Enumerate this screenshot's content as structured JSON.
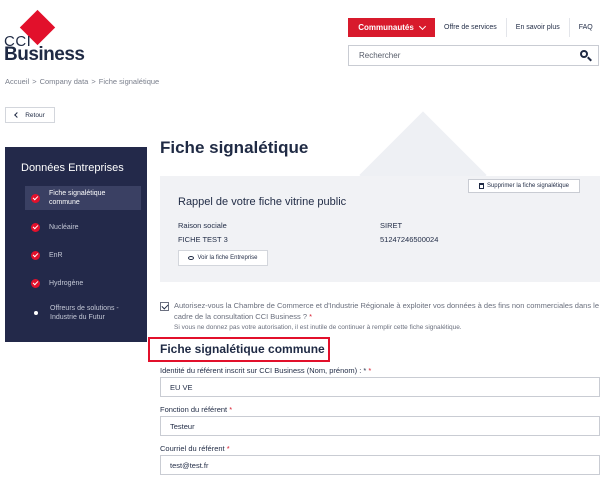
{
  "logo": {
    "line1": "CCI",
    "line2": "Business"
  },
  "nav": {
    "communautes": "Communautés",
    "links": [
      "Offre de services",
      "En savoir plus",
      "FAQ"
    ]
  },
  "search": {
    "placeholder": "Rechercher"
  },
  "breadcrumb": [
    "Accueil",
    ">",
    "Company data",
    ">",
    "Fiche signalétique"
  ],
  "back_label": "Retour",
  "sidebar": {
    "title": "Données Entreprises",
    "items": [
      {
        "label": "Fiche signalétique commune",
        "state": "checked",
        "active": true
      },
      {
        "label": "Nucléaire",
        "state": "checked",
        "active": false
      },
      {
        "label": "EnR",
        "state": "checked",
        "active": false
      },
      {
        "label": "Hydrogène",
        "state": "checked",
        "active": false
      },
      {
        "label": "Offreurs de solutions - Industrie du Futur",
        "state": "dot",
        "active": false
      }
    ]
  },
  "page_title": "Fiche signalétique",
  "card": {
    "heading": "Rappel de votre fiche vitrine public",
    "delete_label": "Supprimer la fiche signalétique",
    "raison_sociale_label": "Raison sociale",
    "raison_sociale_value": "FICHE TEST 3",
    "siret_label": "SIRET",
    "siret_value": "51247246500024",
    "view_label": "Voir la fiche Entreprise"
  },
  "consent": {
    "text": "Autorisez-vous la Chambre de Commerce et d'Industrie Régionale à exploiter vos données à des fins non commerciales dans le cadre de la consultation CCI Business ?",
    "required_mark": "*",
    "checked": true
  },
  "note": "Si vous ne donnez pas votre autorisation, il est inutile de continuer à remplir cette fiche signalétique.",
  "section_title": "Fiche signalétique commune",
  "fields": [
    {
      "label": "Identité du référent inscrit sur CCI Business (Nom, prénom) : *",
      "required_mark": "*",
      "value": "EU VE"
    },
    {
      "label": "Fonction du référent",
      "required_mark": "*",
      "value": "Testeur"
    },
    {
      "label": "Courriel du référent",
      "required_mark": "*",
      "value": "test@test.fr"
    }
  ],
  "colors": {
    "brand_red": "#e2102b",
    "navy": "#23294a",
    "text": "#1f2a44"
  }
}
